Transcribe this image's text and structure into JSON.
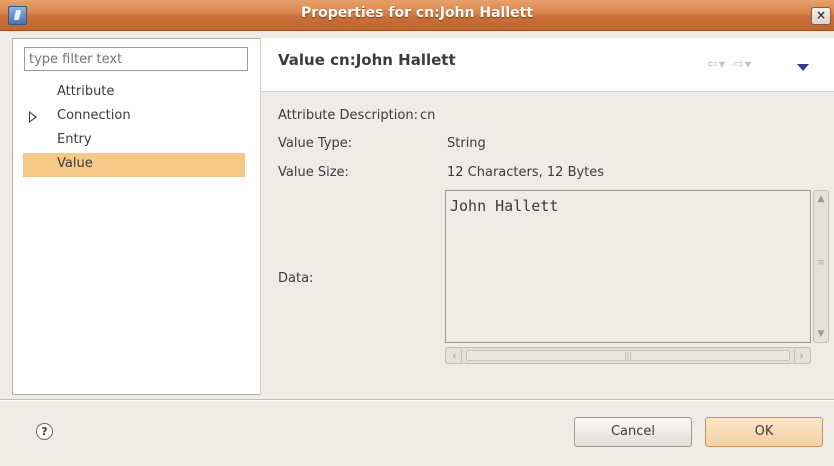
{
  "window": {
    "title": "Properties for cn:John Hallett",
    "close_glyph": "×"
  },
  "sidebar": {
    "filter_placeholder": "type filter text",
    "items": [
      {
        "label": "Attribute"
      },
      {
        "label": "Connection"
      },
      {
        "label": "Entry"
      },
      {
        "label": "Value"
      }
    ],
    "selected": "Value"
  },
  "page": {
    "title": "Value cn:John Hallett",
    "rows": {
      "description_label": "Attribute Description:",
      "description_value": "cn",
      "type_label": "Value Type:",
      "type_value": "String",
      "size_label": "Value Size:",
      "size_value": "12 Characters, 12 Bytes",
      "data_label": "Data:",
      "data_value": "John Hallett"
    }
  },
  "footer": {
    "help_glyph": "?",
    "cancel_label": "Cancel",
    "ok_label": "OK"
  },
  "icons": {
    "app": "window-app-icon",
    "close": "close-icon",
    "back": "back-arrow-icon",
    "forward": "forward-arrow-icon",
    "menu": "view-menu-icon",
    "help": "help-icon",
    "expand": "expand-triangle-icon"
  },
  "colors": {
    "titlebar": "#d7834b",
    "selection": "#f5c885",
    "menu_arrow": "#2d3f82"
  }
}
